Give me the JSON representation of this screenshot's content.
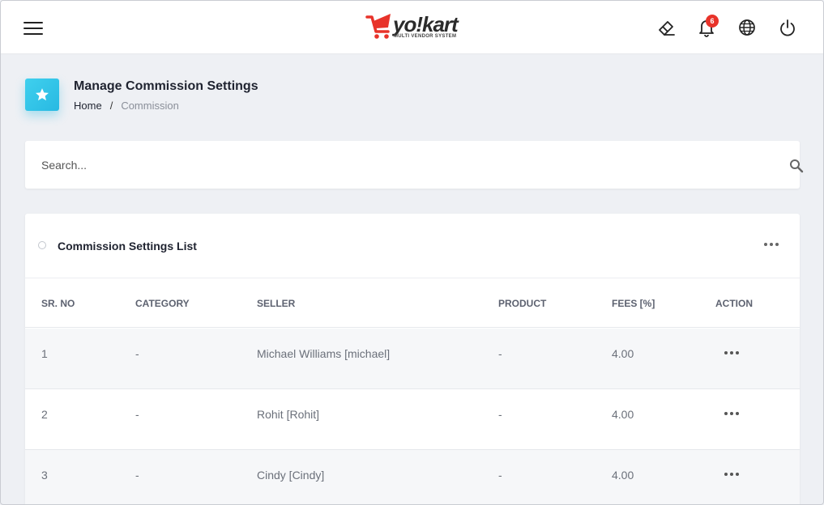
{
  "header": {
    "menu_icon": "hamburger-icon",
    "logo_text": "yo!kart",
    "logo_subtitle": "MULTI VENDOR SYSTEM",
    "brand_color": "#e8332a",
    "icons": [
      "eraser-icon",
      "bell-icon",
      "globe-icon",
      "power-icon"
    ],
    "notification_count": "6"
  },
  "page": {
    "title": "Manage Commission Settings",
    "icon": "star-icon",
    "accent_color": "#2fc4e8",
    "breadcrumb": {
      "home": "Home",
      "separator": "/",
      "current": "Commission"
    }
  },
  "search": {
    "placeholder": "Search...",
    "icon": "search-icon"
  },
  "list": {
    "title": "Commission Settings List",
    "columns": [
      "SR. NO",
      "CATEGORY",
      "SELLER",
      "PRODUCT",
      "FEES [%]",
      "ACTION"
    ],
    "rows": [
      {
        "sr": "1",
        "category": "-",
        "seller": "Michael Williams [michael]",
        "product": "-",
        "fees": "4.00"
      },
      {
        "sr": "2",
        "category": "-",
        "seller": "Rohit [Rohit]",
        "product": "-",
        "fees": "4.00"
      },
      {
        "sr": "3",
        "category": "-",
        "seller": "Cindy [Cindy]",
        "product": "-",
        "fees": "4.00"
      }
    ]
  }
}
